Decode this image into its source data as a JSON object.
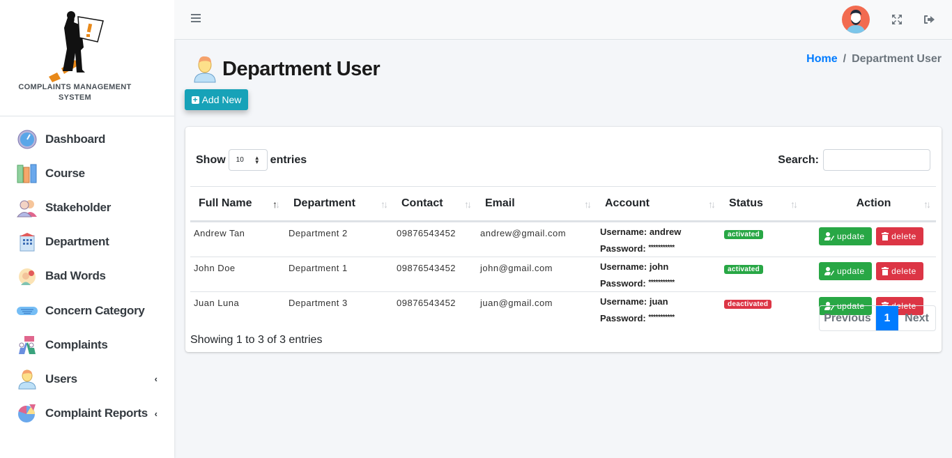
{
  "brand": {
    "name": "COMPLAINTS MANAGEMENT SYSTEM",
    "line1": "COMPLAINTS MANAGEMENT",
    "line2": "SYSTEM"
  },
  "sidebar": {
    "items": [
      {
        "label": "Dashboard",
        "icon": "dashboard-gauge-icon",
        "has_submenu": false
      },
      {
        "label": "Course",
        "icon": "books-icon",
        "has_submenu": false
      },
      {
        "label": "Stakeholder",
        "icon": "stakeholder-people-icon",
        "has_submenu": false
      },
      {
        "label": "Department",
        "icon": "building-icon",
        "has_submenu": false
      },
      {
        "label": "Bad Words",
        "icon": "bad-words-icon",
        "has_submenu": false
      },
      {
        "label": "Concern Category",
        "icon": "category-icon",
        "has_submenu": false
      },
      {
        "label": "Complaints",
        "icon": "complaints-icon",
        "has_submenu": false
      },
      {
        "label": "Users",
        "icon": "user-icon",
        "has_submenu": true
      },
      {
        "label": "Complaint Reports",
        "icon": "pie-chart-icon",
        "has_submenu": true
      }
    ],
    "chevron": "‹"
  },
  "topbar": {
    "menu_icon": "hamburger-icon",
    "avatar_icon": "avatar",
    "fullscreen_icon": "expand-icon",
    "logout_icon": "logout-icon"
  },
  "page": {
    "title": "Department User",
    "breadcrumb": {
      "home": "Home",
      "separator": "/",
      "current": "Department User"
    },
    "add_button": "Add New"
  },
  "table_controls": {
    "show_label": "Show",
    "entries_label": "entries",
    "page_length": "10",
    "search_label": "Search:",
    "search_value": ""
  },
  "table": {
    "columns": [
      "Full Name",
      "Department",
      "Contact",
      "Email",
      "Account",
      "Status",
      "Action"
    ],
    "rows": [
      {
        "full_name": "Andrew Tan",
        "department": "Department 2",
        "contact": "09876543452",
        "email": "andrew@gmail.com",
        "username_label": "Username:",
        "username": "andrew",
        "password_label": "Password:",
        "password": "***********",
        "status": "activated"
      },
      {
        "full_name": "John Doe",
        "department": "Department 1",
        "contact": "09876543452",
        "email": "john@gmail.com",
        "username_label": "Username:",
        "username": "john",
        "password_label": "Password:",
        "password": "***********",
        "status": "activated"
      },
      {
        "full_name": "Juan Luna",
        "department": "Department 3",
        "contact": "09876543452",
        "email": "juan@gmail.com",
        "username_label": "Username:",
        "username": "juan",
        "password_label": "Password:",
        "password": "***********",
        "status": "deactivated"
      }
    ],
    "update_label": "update",
    "delete_label": "delete"
  },
  "footer": {
    "info": "Showing 1 to 3 of 3 entries",
    "previous": "Previous",
    "current_page": "1",
    "next": "Next"
  },
  "colors": {
    "primary": "#007bff",
    "info": "#17a2b8",
    "success": "#28a745",
    "danger": "#dc3545"
  }
}
